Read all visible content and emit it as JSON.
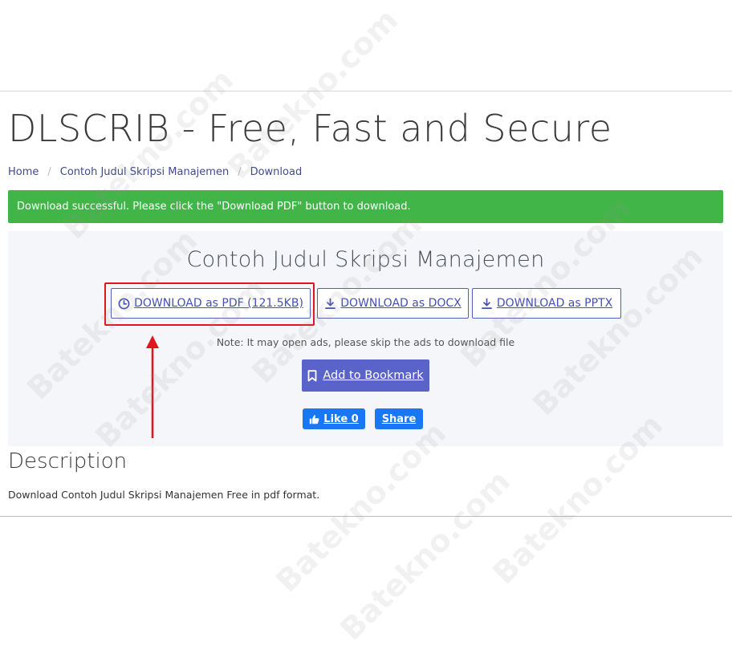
{
  "site": {
    "title": "DLSCRIB - Free, Fast and Secure"
  },
  "breadcrumb": {
    "items": [
      "Home",
      "Contoh Judul Skripsi Manajemen",
      "Download"
    ],
    "separator": "/"
  },
  "alert": {
    "message": "Download successful. Please click the \"Download PDF\" button to download.",
    "color": "#42b549"
  },
  "document": {
    "title": "Contoh Judul Skripsi Manajemen",
    "buttons": {
      "pdf": "DOWNLOAD as PDF (121.5KB)",
      "docx": "DOWNLOAD as DOCX",
      "pptx": "DOWNLOAD as PPTX"
    },
    "note": "Note: It may open ads, please skip the ads to download file",
    "bookmark": "Add to Bookmark",
    "like": "Like 0",
    "share": "Share"
  },
  "description": {
    "heading": "Description",
    "text": "Download Contoh Judul Skripsi Manajemen Free in pdf format."
  },
  "watermark": {
    "text": "Batekno.com"
  },
  "colors": {
    "accent": "#5a63c9",
    "highlight": "#e0161e",
    "facebook": "#1877f2"
  },
  "icons": [
    "clock-icon",
    "download-icon",
    "bookmark-icon",
    "thumbs-up-icon"
  ]
}
